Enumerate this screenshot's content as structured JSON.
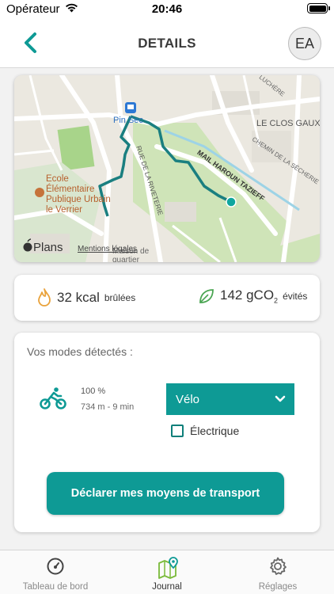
{
  "status_bar": {
    "carrier": "Opérateur",
    "time": "20:46"
  },
  "header": {
    "title": "DETAILS",
    "avatar_initials": "EA",
    "back_icon": "chevron-left-icon"
  },
  "map": {
    "labels": {
      "station": "Pin Sec",
      "clos_gaux": "LE CLOS GAUX",
      "rue_riveterie": "RUE DE LA RIVETERIE",
      "mail_tazieff": "MAIL HAROUN TAZIEFF",
      "chemin_secherie": "CHEMIN DE LA SÈCHERIE",
      "school": [
        "Ecole",
        "Élémentaire",
        "Publique Urbain",
        "le Verrier"
      ],
      "maison_quartier": [
        "Maison de",
        "quartier"
      ],
      "mentions": "Mentions légales",
      "attribution": "Plans",
      "top_street": "LUCHÈRE"
    },
    "route_color": "#1a7f80"
  },
  "stats": {
    "calories_value": "32 kcal",
    "calories_unit": "brûlées",
    "co2_value": "142 gCO",
    "co2_sub": "2",
    "co2_unit": "évités",
    "calories_icon": "flame-icon",
    "co2_icon": "leaf-icon"
  },
  "modes": {
    "title": "Vos modes détectés :",
    "detected": [
      {
        "icon": "bicycle-icon",
        "percent": "100 %",
        "distance_time": "734 m - 9 min"
      }
    ],
    "selected_mode": "Vélo",
    "electric_label": "Électrique",
    "electric_checked": false,
    "declare_button": "Déclarer mes moyens de transport"
  },
  "tabbar": {
    "tabs": [
      {
        "label": "Tableau de bord",
        "icon": "gauge-icon",
        "active": false
      },
      {
        "label": "Journal",
        "icon": "map-pin-icon",
        "active": true
      },
      {
        "label": "Réglages",
        "icon": "gear-icon",
        "active": false
      }
    ]
  },
  "colors": {
    "accent": "#0e9a95",
    "accent_dark": "#1a7f80",
    "flame": "#e9a23b",
    "leaf": "#4aa552"
  }
}
